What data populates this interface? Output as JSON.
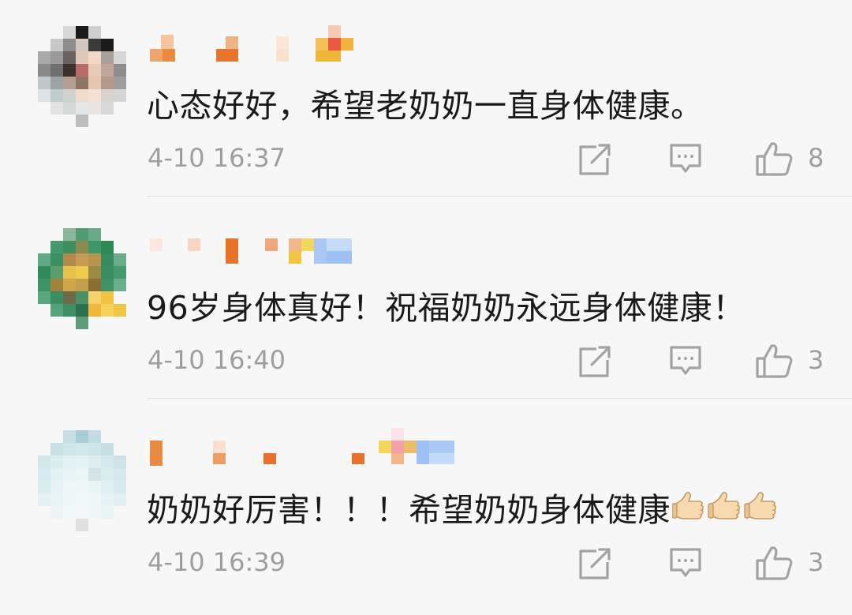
{
  "comments": [
    {
      "text": "心态好好，希望老奶奶一直身体健康。",
      "time": "4-10 16:37",
      "likes": "8",
      "emoji": []
    },
    {
      "text": "96岁身体真好！祝福奶奶永远身体健康！",
      "time": "4-10 16:40",
      "likes": "3",
      "emoji": []
    },
    {
      "text": "奶奶好厉害！！！希望奶奶身体健康",
      "time": "4-10 16:39",
      "likes": "3",
      "emoji": [
        "thumbs-up",
        "thumbs-up",
        "thumbs-up"
      ]
    }
  ],
  "colors": {
    "text": "#1a1a1a",
    "meta": "#9e9e9e",
    "icon": "#a3a3a3",
    "divider": "#e2e2e2",
    "background": "#f7f7f7"
  }
}
